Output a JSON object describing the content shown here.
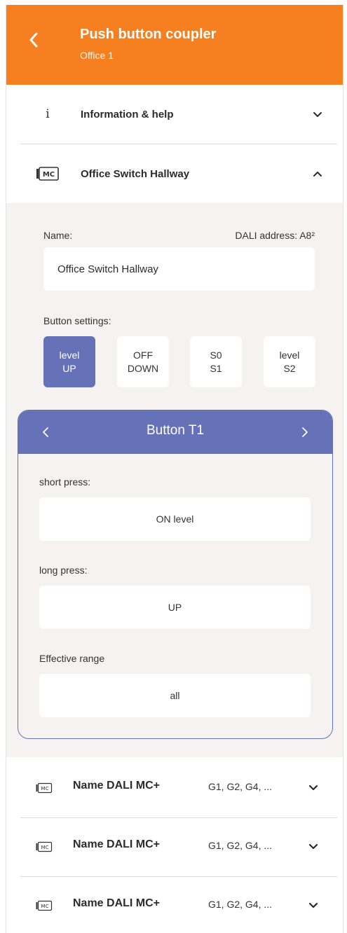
{
  "header": {
    "title": "Push button coupler",
    "subtitle": "Office 1",
    "color": "#f6801f"
  },
  "info_section": {
    "label": "Information & help",
    "icon": "info-icon",
    "chevron": "chevron-down-icon"
  },
  "device_section": {
    "label": "Office Switch Hallway",
    "icon": "mc-device-icon",
    "chevron": "chevron-up-icon",
    "name_label": "Name:",
    "dali_address": "DALI address: A8²",
    "name_value": "Office Switch Hallway",
    "button_settings_label": "Button settings:",
    "buttons": [
      {
        "line1": "level",
        "line2": "UP",
        "active": true
      },
      {
        "line1": "OFF",
        "line2": "DOWN",
        "active": false
      },
      {
        "line1": "S0",
        "line2": "S1",
        "active": false
      },
      {
        "line1": "level",
        "line2": "S2",
        "active": false
      }
    ],
    "card": {
      "title": "Button T1",
      "short_press_label": "short press:",
      "short_press_value": "ON level",
      "long_press_label": "long press:",
      "long_press_value": "UP",
      "range_label": "Effective range",
      "range_value": "all"
    }
  },
  "devices": [
    {
      "name": "Name DALI MC+",
      "groups": "G1, G2, G4, ..."
    },
    {
      "name": "Name DALI MC+",
      "groups": "G1, G2, G4, ..."
    },
    {
      "name": "Name DALI MC+",
      "groups": "G1, G2, G4, ..."
    }
  ],
  "colors": {
    "accent": "#6572b8",
    "panel_bg": "#f5f2f1"
  }
}
